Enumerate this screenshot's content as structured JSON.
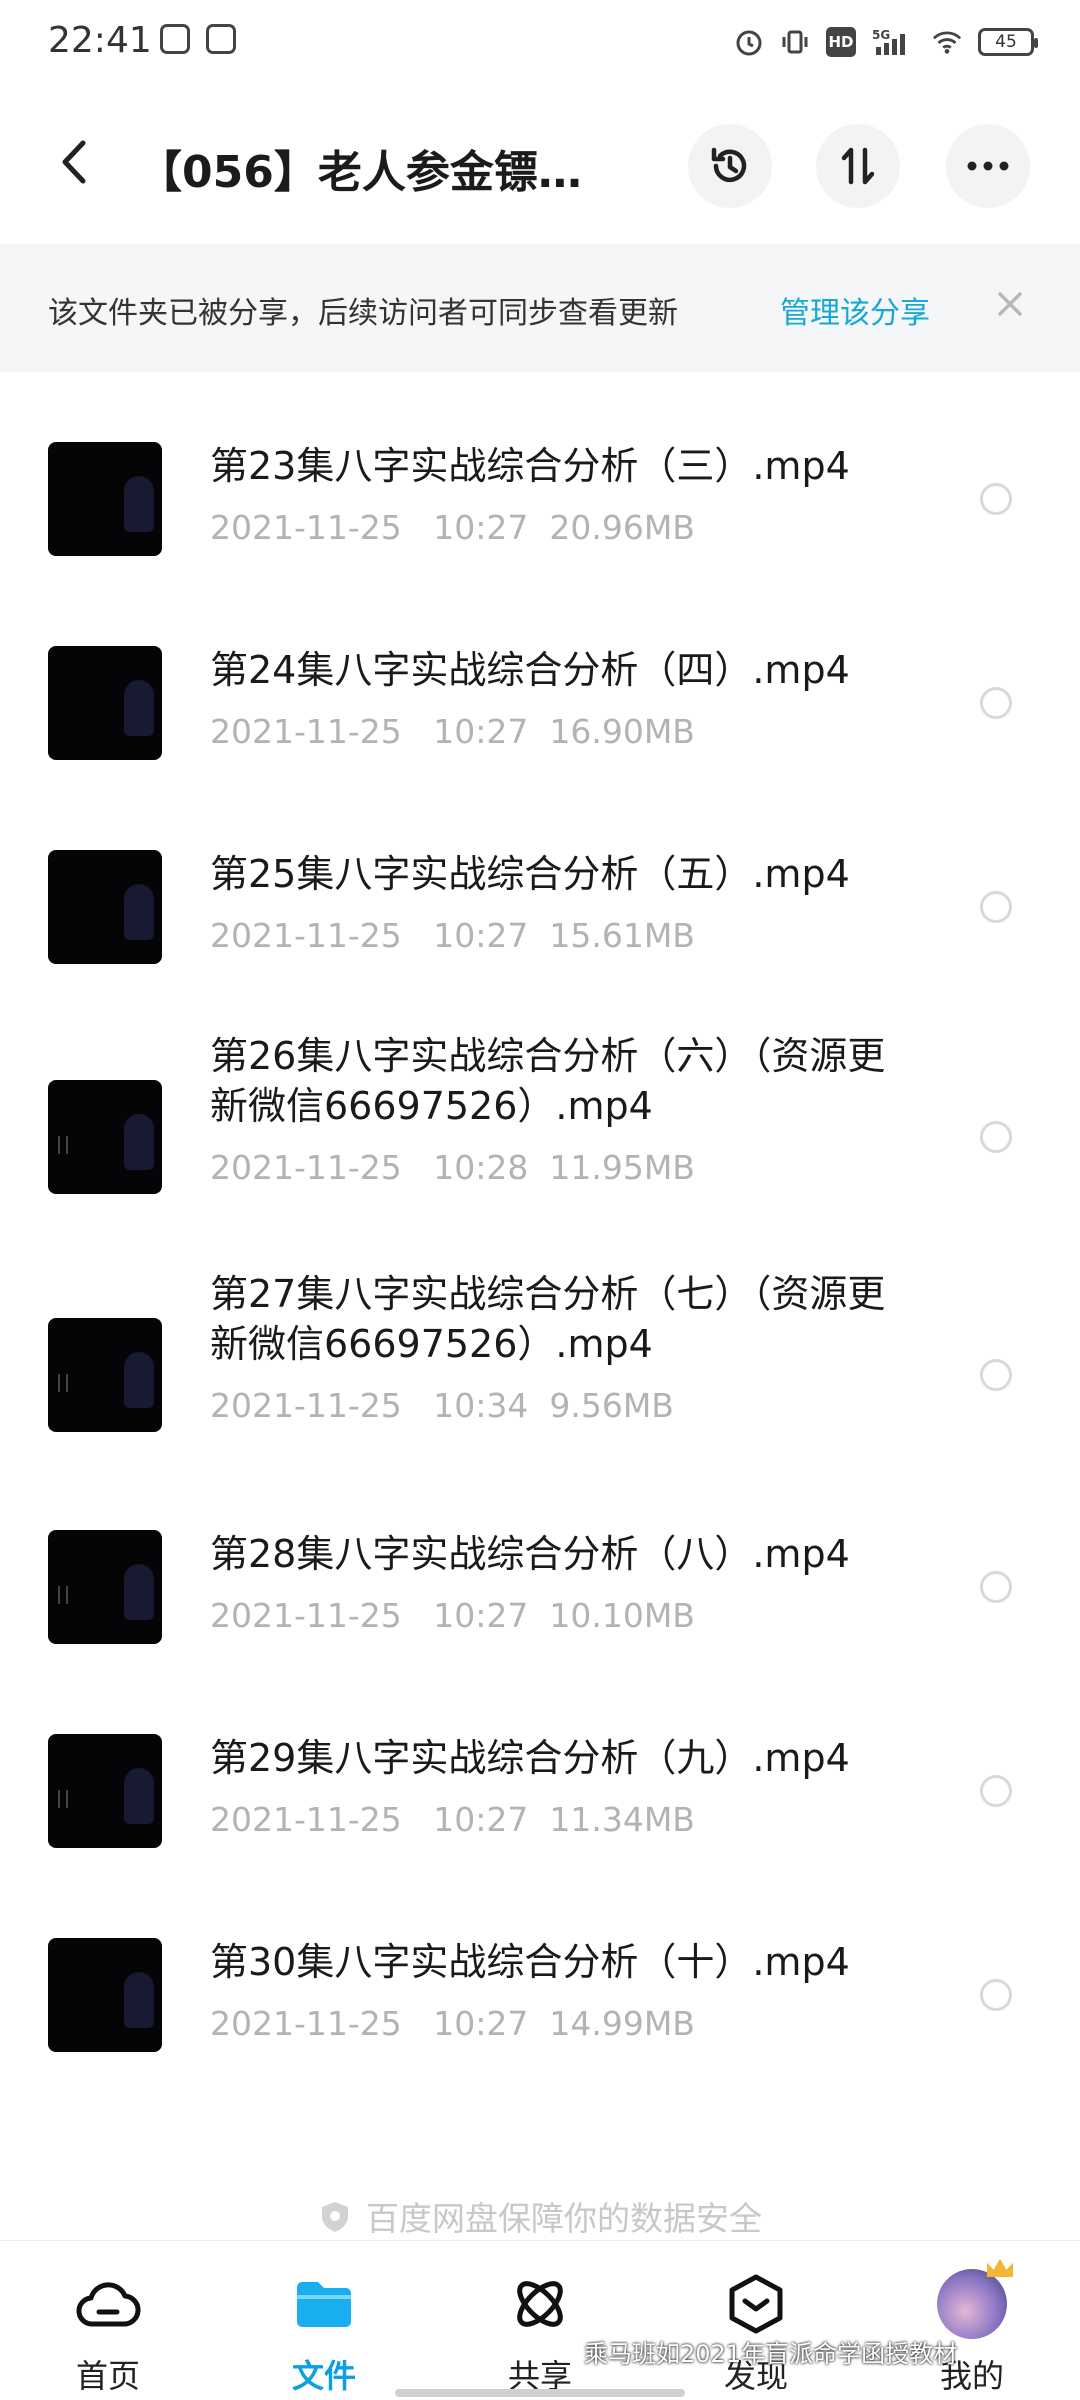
{
  "status_bar": {
    "time": "22:41",
    "network": "5G",
    "hd": "HD",
    "battery": "45"
  },
  "header": {
    "title": "【056】老人参金镖…"
  },
  "banner": {
    "text": "该文件夹已被分享，后续访问者可同步查看更新",
    "link": "管理该分享"
  },
  "files": [
    {
      "name": "第23集八字实战综合分析（三）.mp4",
      "date": "2021-11-25",
      "time": "10:27",
      "size": "20.96MB"
    },
    {
      "name": "第24集八字实战综合分析（四）.mp4",
      "date": "2021-11-25",
      "time": "10:27",
      "size": "16.90MB"
    },
    {
      "name": "第25集八字实战综合分析（五）.mp4",
      "date": "2021-11-25",
      "time": "10:27",
      "size": "15.61MB"
    },
    {
      "name": "第26集八字实战综合分析（六）（资源更新微信66697526）.mp4",
      "date": "2021-11-25",
      "time": "10:28",
      "size": "11.95MB"
    },
    {
      "name": "第27集八字实战综合分析（七）（资源更新微信66697526）.mp4",
      "date": "2021-11-25",
      "time": "10:34",
      "size": "9.56MB"
    },
    {
      "name": "第28集八字实战综合分析（八）.mp4",
      "date": "2021-11-25",
      "time": "10:27",
      "size": "10.10MB"
    },
    {
      "name": "第29集八字实战综合分析（九）.mp4",
      "date": "2021-11-25",
      "time": "10:27",
      "size": "11.34MB"
    },
    {
      "name": "第30集八字实战综合分析（十）.mp4",
      "date": "2021-11-25",
      "time": "10:27",
      "size": "14.99MB"
    }
  ],
  "footer_note": "百度网盘保障你的数据安全",
  "nav": {
    "home": "首页",
    "files": "文件",
    "share": "共享",
    "discover": "发现",
    "mine": "我的"
  },
  "watermark": "乘马班如2021年盲派命学函授教材",
  "colors": {
    "accent": "#0aa0e6",
    "link": "#17a8d8",
    "meta": "#b3b3b3"
  }
}
